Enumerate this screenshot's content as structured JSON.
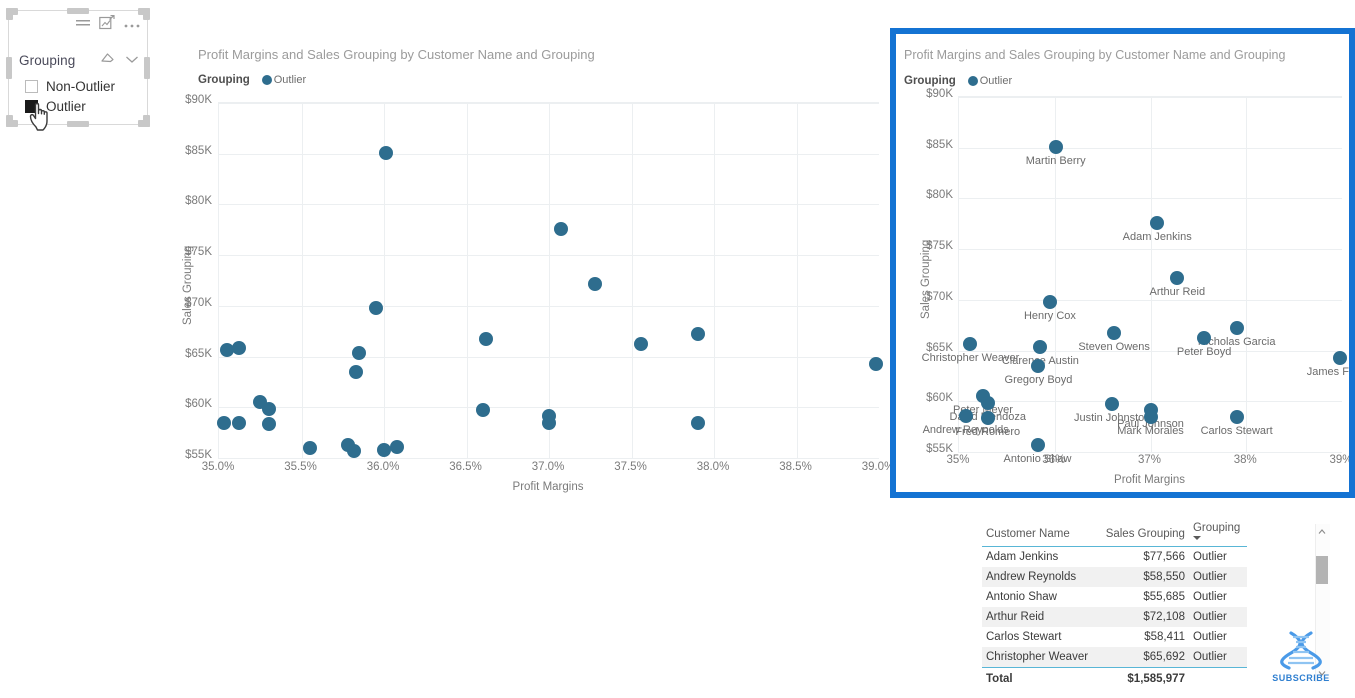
{
  "slicer": {
    "title": "Grouping",
    "items": [
      {
        "label": "Non-Outlier",
        "checked": false
      },
      {
        "label": "Outlier",
        "checked": true
      }
    ],
    "header_icons": [
      "filter-icon",
      "focus-mode-icon",
      "more-options-icon"
    ],
    "title_icons": [
      "eraser-icon",
      "chevron-down-icon"
    ]
  },
  "left_chart": {
    "title": "Profit Margins and Sales Grouping by Customer Name and Grouping",
    "legend_title": "Grouping",
    "legend_value": "Outlier"
  },
  "right_chart": {
    "title": "Profit Margins and Sales Grouping by Customer Name and Grouping",
    "legend_title": "Grouping",
    "legend_value": "Outlier",
    "selected": true,
    "border_color": "#1473d3"
  },
  "table": {
    "columns": [
      "Customer Name",
      "Sales Grouping",
      "Grouping"
    ],
    "sorted_column": "Grouping",
    "rows": [
      {
        "name": "Adam Jenkins",
        "sales": "$77,566",
        "grouping": "Outlier"
      },
      {
        "name": "Andrew Reynolds",
        "sales": "$58,550",
        "grouping": "Outlier"
      },
      {
        "name": "Antonio Shaw",
        "sales": "$55,685",
        "grouping": "Outlier"
      },
      {
        "name": "Arthur Reid",
        "sales": "$72,108",
        "grouping": "Outlier"
      },
      {
        "name": "Carlos Stewart",
        "sales": "$58,411",
        "grouping": "Outlier"
      },
      {
        "name": "Christopher Weaver",
        "sales": "$65,692",
        "grouping": "Outlier"
      }
    ],
    "total_label": "Total",
    "total_value": "$1,585,977"
  },
  "watermark": {
    "label": "SUBSCRIBE",
    "icon": "dna-helix-icon",
    "color": "#2f7fd0"
  },
  "chart_data": {
    "type": "scatter",
    "title": "Profit Margins and Sales Grouping by Customer Name and Grouping",
    "xlabel": "Profit Margins",
    "ylabel": "Sales Grouping",
    "series_name": "Outlier",
    "marker_color": "#2e6d8e",
    "xlim": [
      0.35,
      0.39
    ],
    "ylim": [
      55000,
      90000
    ],
    "xticks_left": [
      "35.0%",
      "35.5%",
      "36.0%",
      "36.5%",
      "37.0%",
      "37.5%",
      "38.0%",
      "38.5%",
      "39.0%"
    ],
    "xticks_right": [
      "35%",
      "36%",
      "37%",
      "38%",
      "39%"
    ],
    "yticks": [
      "$55K",
      "$60K",
      "$65K",
      "$70K",
      "$75K",
      "$80K",
      "$85K",
      "$90K"
    ],
    "grid": true,
    "legend_position": "top-left",
    "points": [
      {
        "label": "Martin Berry",
        "x": 0.3601,
        "y": 85060
      },
      {
        "label": "Adam Jenkins",
        "x": 0.3707,
        "y": 77566
      },
      {
        "label": "Arthur Reid",
        "x": 0.3728,
        "y": 72108
      },
      {
        "label": "Henry Cox",
        "x": 0.3595,
        "y": 69820
      },
      {
        "label": "Nicholas Garcia",
        "x": 0.379,
        "y": 67250
      },
      {
        "label": "Steven Owens",
        "x": 0.3662,
        "y": 66780
      },
      {
        "label": "Peter Boyd",
        "x": 0.3756,
        "y": 66250
      },
      {
        "label": "James Foster",
        "x": 0.3898,
        "y": 64280
      },
      {
        "label": "Christopher Weaver",
        "x": 0.3512,
        "y": 65692
      },
      {
        "label": "Clarence Austin",
        "x": 0.3585,
        "y": 65320
      },
      {
        "label": "Gregory Boyd",
        "x": 0.3583,
        "y": 63500
      },
      {
        "label": "Peter Meyer",
        "x": 0.3525,
        "y": 60520
      },
      {
        "label": "Justin Johnston",
        "x": 0.366,
        "y": 59740
      },
      {
        "label": "David Mendoza",
        "x": 0.353,
        "y": 59820
      },
      {
        "label": "Paul Johnson",
        "x": 0.37,
        "y": 59100
      },
      {
        "label": "Mark Morales",
        "x": 0.37,
        "y": 58450
      },
      {
        "label": "Andrew Reynolds",
        "x": 0.3507,
        "y": 58550
      },
      {
        "label": "Carlos Stewart",
        "x": 0.379,
        "y": 58411
      },
      {
        "label": "Fred Romero",
        "x": 0.353,
        "y": 58350
      },
      {
        "label": "Antonio Shaw",
        "x": 0.3582,
        "y": 55685
      }
    ],
    "left_panel_points": [
      {
        "x": 0.3601,
        "y": 85060
      },
      {
        "x": 0.3707,
        "y": 77566
      },
      {
        "x": 0.3728,
        "y": 72108
      },
      {
        "x": 0.3595,
        "y": 69820
      },
      {
        "x": 0.379,
        "y": 67250
      },
      {
        "x": 0.3662,
        "y": 66780
      },
      {
        "x": 0.3756,
        "y": 66250
      },
      {
        "x": 0.3898,
        "y": 64280
      },
      {
        "x": 0.3505,
        "y": 65680
      },
      {
        "x": 0.3512,
        "y": 65880
      },
      {
        "x": 0.3585,
        "y": 65320
      },
      {
        "x": 0.3583,
        "y": 63500
      },
      {
        "x": 0.3525,
        "y": 60520
      },
      {
        "x": 0.366,
        "y": 59740
      },
      {
        "x": 0.353,
        "y": 59820
      },
      {
        "x": 0.37,
        "y": 59100
      },
      {
        "x": 0.37,
        "y": 58450
      },
      {
        "x": 0.3503,
        "y": 58480
      },
      {
        "x": 0.3512,
        "y": 58420
      },
      {
        "x": 0.379,
        "y": 58411
      },
      {
        "x": 0.353,
        "y": 58350
      },
      {
        "x": 0.3555,
        "y": 56000
      },
      {
        "x": 0.3578,
        "y": 56300
      },
      {
        "x": 0.3582,
        "y": 55685
      },
      {
        "x": 0.36,
        "y": 55760
      },
      {
        "x": 0.3608,
        "y": 56120
      }
    ]
  }
}
